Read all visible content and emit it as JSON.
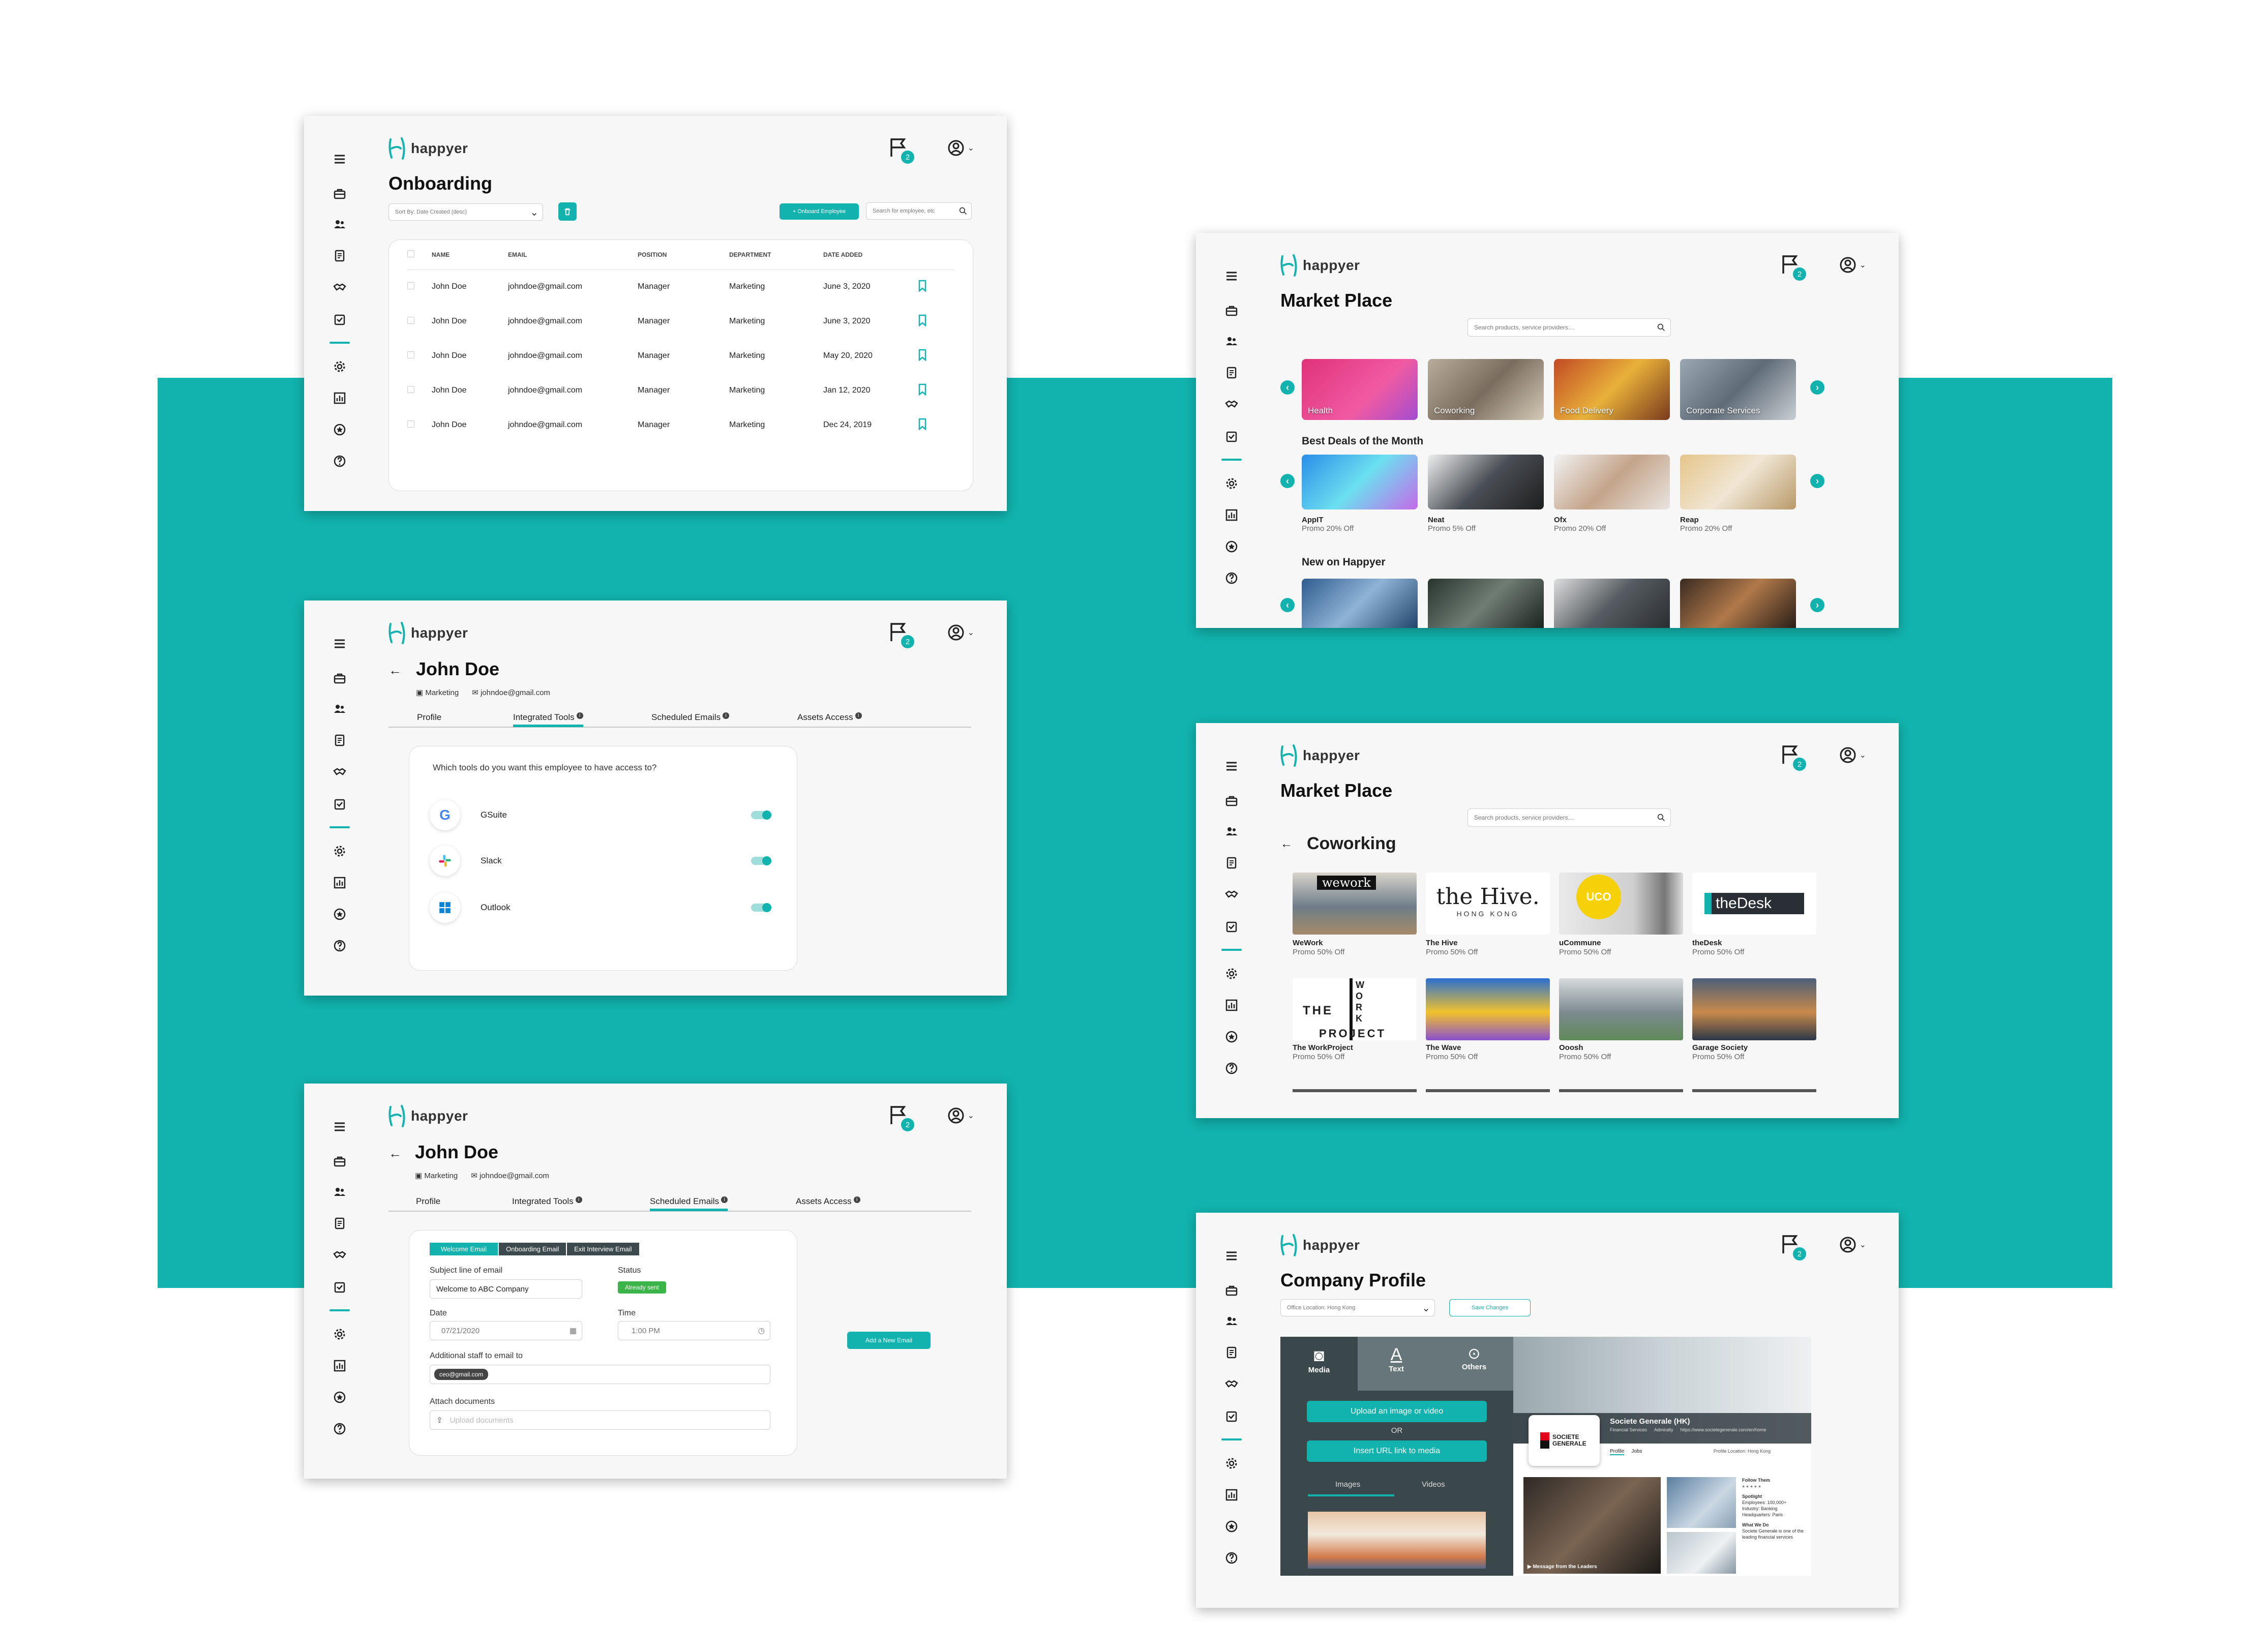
{
  "brand": {
    "name": "happyer",
    "teal": "#12b3ae"
  },
  "common": {
    "flag_count": "2",
    "sidebar_icons": [
      "menu-icon",
      "briefcase-icon",
      "users-icon",
      "document-icon",
      "handshake-icon",
      "inbox-icon",
      "settings-icon",
      "chart-icon",
      "badge-icon",
      "help-icon"
    ]
  },
  "onboarding": {
    "title": "Onboarding",
    "sort_label": "Sort By: Date Created (desc)",
    "onboard_button": "+ Onboard Employee",
    "search_placeholder": "Search for employee, etc",
    "columns": [
      "NAME",
      "EMAIL",
      "POSITION",
      "DEPARTMENT",
      "DATE ADDED"
    ],
    "rows": [
      {
        "name": "John Doe",
        "email": "johndoe@gmail.com",
        "position": "Manager",
        "department": "Marketing",
        "date": "June 3, 2020"
      },
      {
        "name": "John Doe",
        "email": "johndoe@gmail.com",
        "position": "Manager",
        "department": "Marketing",
        "date": "June 3, 2020"
      },
      {
        "name": "John Doe",
        "email": "johndoe@gmail.com",
        "position": "Manager",
        "department": "Marketing",
        "date": "May 20, 2020"
      },
      {
        "name": "John Doe",
        "email": "johndoe@gmail.com",
        "position": "Manager",
        "department": "Marketing",
        "date": "Jan 12, 2020"
      },
      {
        "name": "John Doe",
        "email": "johndoe@gmail.com",
        "position": "Manager",
        "department": "Marketing",
        "date": "Dec 24, 2019"
      }
    ]
  },
  "employee": {
    "name": "John Doe",
    "department": "Marketing",
    "email": "johndoe@gmail.com",
    "tabs": [
      "Profile",
      "Integrated Tools",
      "Scheduled Emails",
      "Assets Access"
    ]
  },
  "tools": {
    "question": "Which tools do you want this employee to have access to?",
    "items": [
      "GSuite",
      "Slack",
      "Outlook"
    ]
  },
  "emails": {
    "email_tabs": [
      "Welcome Email",
      "Onboarding Email",
      "Exit Interview Email"
    ],
    "subject_label": "Subject line of email",
    "subject_value": "Welcome to ABC Company",
    "status_label": "Status",
    "status_value": "Already sent",
    "date_label": "Date",
    "date_value": "07/21/2020",
    "time_label": "Time",
    "time_value": "1:00 PM",
    "staff_label": "Additional staff to email to",
    "staff_chip": "ceo@gmail.com",
    "attach_label": "Attach documents",
    "upload_placeholder": "Upload documents",
    "add_button": "Add a New Email"
  },
  "market": {
    "title": "Market Place",
    "search_placeholder": "Search products, service providers....",
    "categories": [
      "Health",
      "Coworking",
      "Food Delivery",
      "Corporate Services"
    ],
    "best_deals_title": "Best Deals of the Month",
    "deals": [
      {
        "name": "AppIT",
        "promo": "Promo 20% Off"
      },
      {
        "name": "Neat",
        "promo": "Promo 5% Off"
      },
      {
        "name": "Ofx",
        "promo": "Promo 20% Off"
      },
      {
        "name": "Reap",
        "promo": "Promo 20% Off"
      }
    ],
    "new_title": "New on Happyer"
  },
  "coworking": {
    "title": "Coworking",
    "spaces": [
      {
        "name": "WeWork",
        "promo": "Promo 50% Off",
        "logo": "wework"
      },
      {
        "name": "The Hive",
        "promo": "Promo 50% Off",
        "logo": "the Hive.",
        "logo_sub": "HONG KONG"
      },
      {
        "name": "uCommune",
        "promo": "Promo 50% Off",
        "logo": "UCO"
      },
      {
        "name": "theDesk",
        "promo": "Promo 50% Off",
        "logo": "theDesk"
      },
      {
        "name": "The WorkProject",
        "promo": "Promo 50% Off",
        "logo_top": "THE",
        "logo_work": "W O R K",
        "logo_bottom": "PROJECT"
      },
      {
        "name": "The Wave",
        "promo": "Promo 50% Off"
      },
      {
        "name": "Ooosh",
        "promo": "Promo 50% Off"
      },
      {
        "name": "Garage Society",
        "promo": "Promo 50% Off"
      }
    ]
  },
  "company": {
    "title": "Company Profile",
    "location_select": "Office Location: Hong Kong",
    "save_button": "Save Changes",
    "editor_tabs": [
      "Media",
      "Text",
      "Others"
    ],
    "upload_button": "Upload an image or video",
    "or_text": "OR",
    "url_button": "Insert URL link to media",
    "media_tabs": [
      "Images",
      "Videos"
    ],
    "company_name": "Societe Generale (HK)",
    "logo_text": "SOCIETE GENERALE",
    "meta": [
      "Financial Services",
      "Admiralty",
      "https://www.societegenerale.com/en/home"
    ],
    "profile_tabs": [
      "Profile",
      "Jobs"
    ],
    "profile_location": "Profile Location: Hong Kong",
    "video_caption": "Message from the Leaders",
    "follow_title": "Follow Them",
    "spotlight_title": "Spotlight",
    "spotlight": [
      "Employees: 100,000+",
      "Industry: Banking",
      "Headquarters: Paris"
    ],
    "what_title": "What We Do",
    "what_text": "Societe Generale is one of the leading financial services"
  }
}
